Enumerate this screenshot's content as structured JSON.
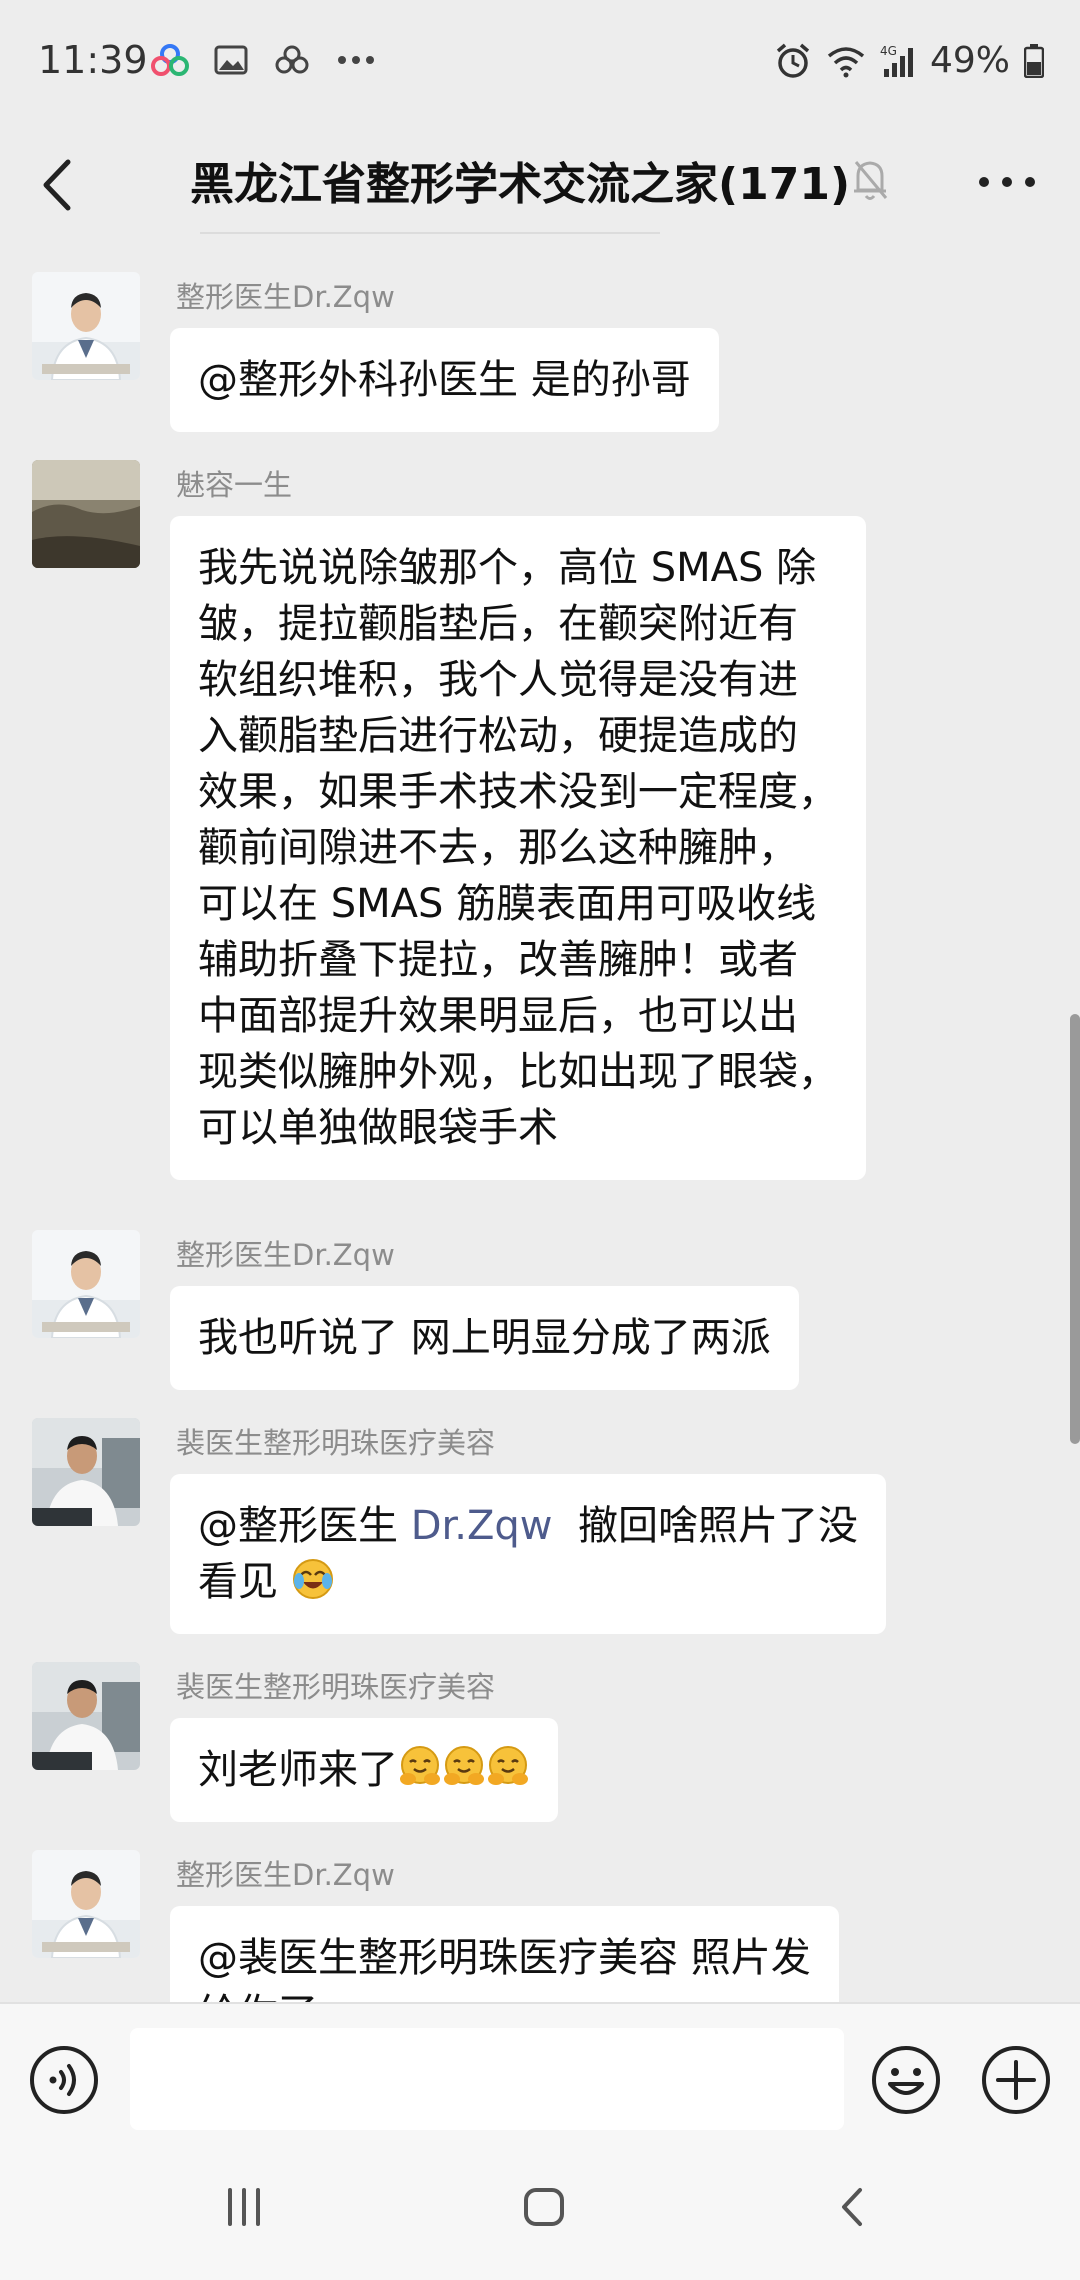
{
  "status_bar": {
    "time": "11:39",
    "battery": "49%",
    "left_icons": [
      "multi-circle-icon",
      "image-icon",
      "link-icon",
      "more-dots-icon"
    ],
    "right_icons": [
      "alarm-icon",
      "wifi-icon",
      "4g-signal-icon",
      "battery-icon"
    ]
  },
  "header": {
    "title": "黑龙江省整形学术交流之家(171)",
    "mute_icon": "bell-off-icon",
    "more_icon": "more-icon"
  },
  "messages": [
    {
      "sender": "整形医生Dr.Zqw",
      "lines": [
        "@整形外科孙医生  是的孙哥"
      ]
    },
    {
      "sender": "魅容一生",
      "lines": [
        "我先说说除皱那个，高位 SMAS 除",
        "皱，提拉颧脂垫后，在颧突附近有",
        "软组织堆积，我个人觉得是没有进",
        "入颧脂垫后进行松动，硬提造成的",
        "效果，如果手术技术没到一定程度，",
        "颧前间隙进不去，那么这种臃肿，",
        "可以在 SMAS 筋膜表面用可吸收线",
        "辅助折叠下提拉，改善臃肿！或者",
        "中面部提升效果明显后，也可以出",
        "现类似臃肿外观，比如出现了眼袋，",
        "可以单独做眼袋手术"
      ]
    },
    {
      "sender": "整形医生Dr.Zqw",
      "lines": [
        "我也听说了 网上明显分成了两派"
      ]
    },
    {
      "sender": "裴医生整形明珠医疗美容",
      "line1_prefix": "@整形医生 ",
      "line1_mention": "Dr.Zqw",
      "line1_suffix": "  撤回啥照片了没",
      "line2": "看见"
    },
    {
      "sender": "裴医生整形明珠医疗美容",
      "text": "刘老师来了"
    },
    {
      "sender": "整形医生Dr.Zqw",
      "lines": [
        "@裴医生整形明珠医疗美容  照片发",
        "给你了"
      ]
    }
  ],
  "input_bar": {
    "voice_icon": "voice-icon",
    "emoji_icon": "smiley-icon",
    "plus_icon": "plus-icon",
    "placeholder": ""
  },
  "system_nav": {
    "recents_icon": "recents-icon",
    "home_icon": "home-icon",
    "back_icon": "back-icon"
  }
}
